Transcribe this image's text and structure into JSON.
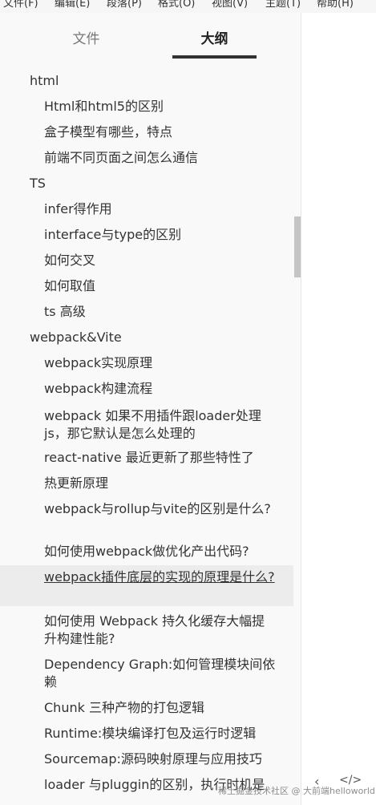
{
  "menubar": {
    "items": [
      "文件(F)",
      "编辑(E)",
      "段落(P)",
      "格式(O)",
      "视图(V)",
      "主题(T)",
      "帮助(H)"
    ]
  },
  "sidebar": {
    "tabs": [
      "文件",
      "大纲"
    ],
    "active_tab": "大纲"
  },
  "outline": [
    {
      "level": 1,
      "text": "html"
    },
    {
      "level": 2,
      "text": "Html和html5的区别"
    },
    {
      "level": 2,
      "text": "盒子模型有哪些，特点"
    },
    {
      "level": 2,
      "text": "前端不同页面之间怎么通信"
    },
    {
      "level": 1,
      "text": "TS"
    },
    {
      "level": 2,
      "text": "infer得作用"
    },
    {
      "level": 2,
      "text": "interface与type的区别"
    },
    {
      "level": 2,
      "text": "如何交叉"
    },
    {
      "level": 2,
      "text": "如何取值"
    },
    {
      "level": 2,
      "text": "ts 高级"
    },
    {
      "level": 1,
      "text": "webpack&Vite"
    },
    {
      "level": 2,
      "text": "webpack实现原理"
    },
    {
      "level": 2,
      "text": "webpack构建流程"
    },
    {
      "level": 2,
      "text": "webpack 如果不用插件跟loader处理js，那它默认是怎么处理的"
    },
    {
      "level": 2,
      "text": "react-native 最近更新了那些特性了"
    },
    {
      "level": 2,
      "text": "热更新原理"
    },
    {
      "level": 2,
      "text": "webpack与rollup与vite的区别是什么?"
    },
    {
      "level": 2,
      "text": "如何使用webpack做优化产出代码?"
    },
    {
      "level": 2,
      "text": "webpack插件底层的实现的原理是什么?"
    },
    {
      "level": 2,
      "text": "如何使用 Webpack 持久化缓存大幅提升构建性能?"
    },
    {
      "level": 2,
      "text": "Dependency Graph:如何管理模块间依赖"
    },
    {
      "level": 2,
      "text": "Chunk 三种产物的打包逻辑"
    },
    {
      "level": 2,
      "text": "Runtime:模块编译打包及运行时逻辑"
    },
    {
      "level": 2,
      "text": "Sourcemap:源码映射原理与应用技巧"
    },
    {
      "level": 2,
      "text": "loader 与pluggin的区别，执行时机是"
    }
  ],
  "footer": {
    "back_glyph": "‹",
    "code_glyph": "</>",
    "watermark": "稀土掘金技术社区 @ 大前端helloworld"
  }
}
